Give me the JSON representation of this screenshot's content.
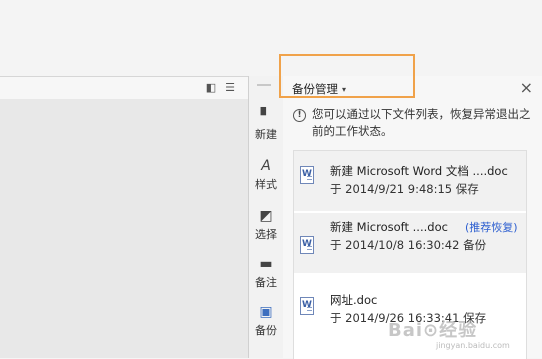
{
  "panel": {
    "title": "备份管理",
    "caret": "▾",
    "close": "×",
    "notice_icon": "!",
    "notice": "您可以通过以下文件列表，恢复异常退出之前的工作状态。"
  },
  "toolbar": {
    "items": [
      {
        "label": "新建",
        "icon": "new-file-icon",
        "glyph": "▘"
      },
      {
        "label": "样式",
        "icon": "style-icon",
        "glyph": "A"
      },
      {
        "label": "选择",
        "icon": "select-icon",
        "glyph": "◩"
      },
      {
        "label": "备注",
        "icon": "note-icon",
        "glyph": "▬"
      },
      {
        "label": "备份",
        "icon": "backup-icon",
        "glyph": "▣"
      }
    ]
  },
  "files": [
    {
      "name": "新建 Microsoft Word 文档 ....doc",
      "date": "于 2014/9/21 9:48:15 保存",
      "action": ""
    },
    {
      "name": "新建 Microsoft ....doc",
      "date": "于 2014/10/8 16:30:42 备份",
      "action": "(推荐恢复)"
    },
    {
      "name": "网址.doc",
      "date": "于 2014/9/26 16:33:41 保存",
      "action": ""
    }
  ],
  "watermark": {
    "text": "Bai⊙经验",
    "sub": "jingyan.baidu.com"
  },
  "colors": {
    "highlight": "#f0a24a",
    "accent_link": "#2d5fd0",
    "active_icon": "#3d6fbf"
  }
}
